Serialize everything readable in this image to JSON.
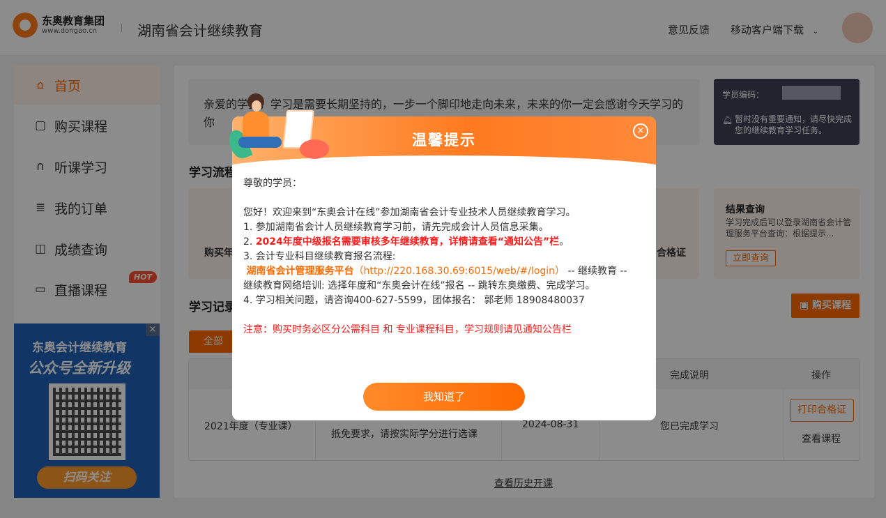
{
  "header": {
    "logo_name": "东奥教育集团",
    "logo_url": "www.dongao.cn",
    "site_title": "湖南省会计继续教育",
    "feedback": "意见反馈",
    "mobile_download": "移动客户端下载",
    "mobile_download_icon": "chevron-down-icon"
  },
  "sidebar": {
    "items": [
      {
        "label": "首页",
        "icon": "home-icon",
        "active": true
      },
      {
        "label": "购买课程",
        "icon": "shopping-bag-icon"
      },
      {
        "label": "听课学习",
        "icon": "headphones-icon"
      },
      {
        "label": "我的订单",
        "icon": "order-list-icon"
      },
      {
        "label": "成绩查询",
        "icon": "search-document-icon"
      },
      {
        "label": "直播课程",
        "icon": "video-camera-icon",
        "badge": "HOT"
      }
    ]
  },
  "promo": {
    "line1": "东奥会计继续教育",
    "line2": "公众号全新升级",
    "button": "扫码关注",
    "close": "×"
  },
  "greeting": {
    "text": "亲爱的学员，学习是需要长期坚持的，一步一个脚印地走向未来，未来的你一定会感谢今天学习的你"
  },
  "student_card": {
    "code_label": "学员编码：",
    "notice": "暂时没有重要通知，请尽快完成您的继续教育学习任务。"
  },
  "flow": {
    "title": "学习流程",
    "buy_label": "购买年",
    "print_label": "合格证",
    "result_title": "结果查询",
    "result_desc": "学习完成后可以登录湖南省会计管理服务平台查询：根据提示...",
    "result_button": "立即查询"
  },
  "records": {
    "title": "学习记录",
    "buy_button": "购买课程",
    "tab_all": "全部",
    "columns": [
      "完成说明",
      "操作"
    ],
    "row": {
      "year": "2021年度（专业课）",
      "note": "抵免要求，请按实际学分进行选课",
      "date": "2024-08-31",
      "status": "您已完成学习",
      "print_button": "打印合格证",
      "view_button": "查看课程"
    },
    "history_link": "查看历史开课"
  },
  "modal": {
    "title": "温馨提示",
    "close": "×",
    "salutation": "尊敬的学员：",
    "welcome": "您好！欢迎来到“东奥会计在线”参加湖南省会计专业技术人员继续教育学习。",
    "item1": "1. 参加湖南省会计人员继续教育学习前，请先完成会计人员信息采集。",
    "item2_prefix": "2. ",
    "item2_bold": "2024年度中级报名需要审核多年继续教育，详情请查看“通知公告”栏",
    "item2_suffix": "。",
    "item3": "3. 会计专业科目继续教育报名流程:",
    "platform_name": "湖南省会计管理服务平台",
    "platform_url": "（http://220.168.30.69:6015/web/#/login）",
    "platform_after": " -- 继续教育 --",
    "item3_line3": "继续教育网络培训: 选择年度和“东奥会计在线”报名 -- 跳转东奥缴费、完成学习。",
    "item4": "4. 学习相关问题，请咨询400-627-5599，团体报名： 郭老师 18908480037",
    "warning": "注意：购买时务必区分公需科目 和 专业课程科目，学习规则请见通知公告栏",
    "confirm": "我知道了"
  },
  "colors": {
    "accent": "#ff6a00",
    "warning_red": "#ff1a1a",
    "card_dark": "#3d4355"
  }
}
